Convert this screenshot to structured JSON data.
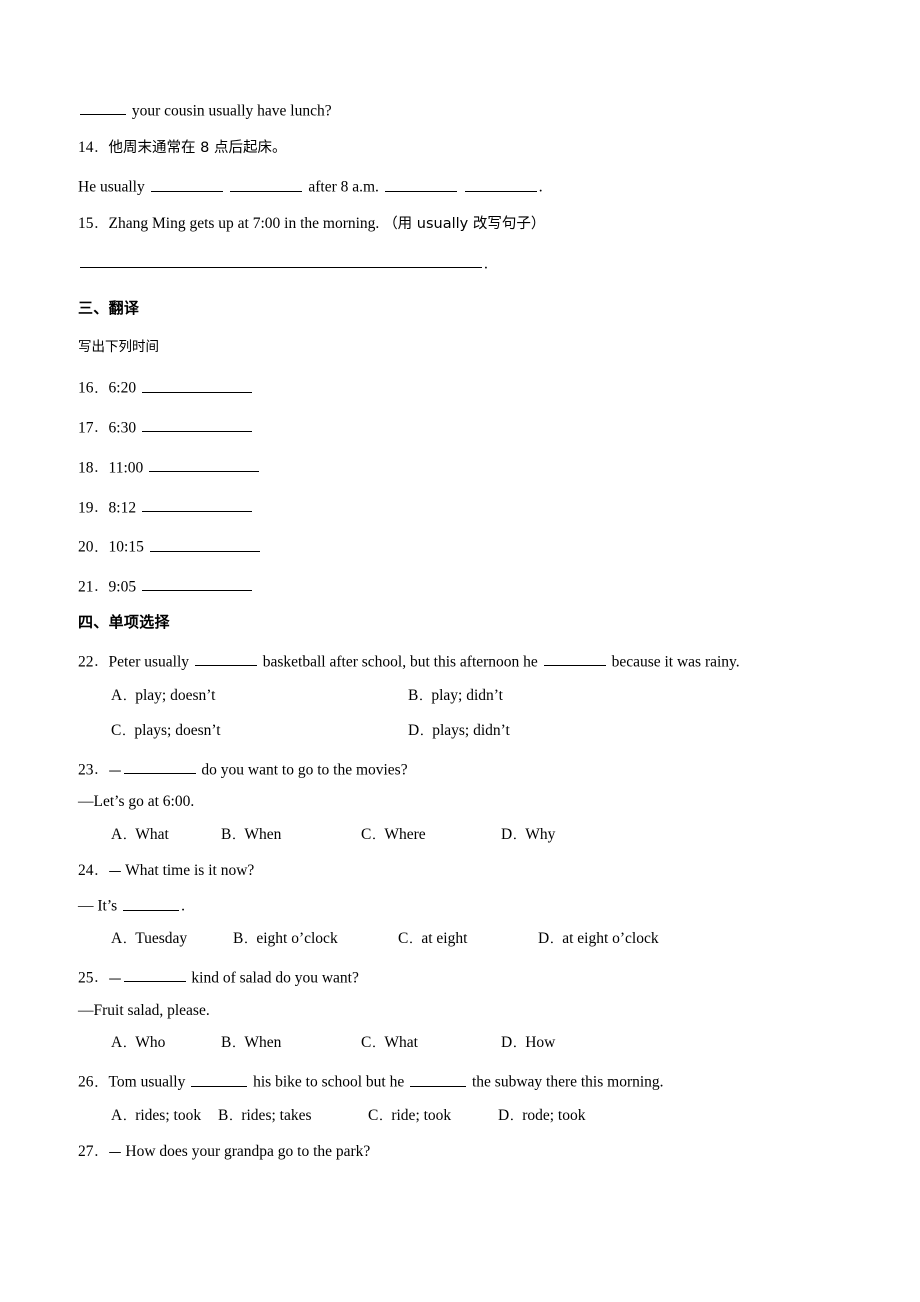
{
  "document": {
    "type": "worksheet",
    "language": "zh-CN/en"
  },
  "top_fragment": {
    "text_after_blank": "your cousin usually have lunch?"
  },
  "item14": {
    "number": "14",
    "sep": "．",
    "chinese": "他周末通常在 8 点后起床。",
    "answer_prefix": "He usually",
    "answer_middle": "after 8 a.m.",
    "answer_suffix": "."
  },
  "item15": {
    "number": "15",
    "sep": "．",
    "prompt": "Zhang Ming gets up at 7:00 in the morning.",
    "instruction": "（用 usually 改写句子）",
    "answer_suffix": "."
  },
  "section3": {
    "heading": "三、翻译",
    "instruction": "写出下列时间",
    "items": [
      {
        "number": "16",
        "sep": "．",
        "time": "6:20"
      },
      {
        "number": "17",
        "sep": "．",
        "time": "6:30"
      },
      {
        "number": "18",
        "sep": "．",
        "time": "11:00"
      },
      {
        "number": "19",
        "sep": "．",
        "time": "8:12"
      },
      {
        "number": "20",
        "sep": "．",
        "time": "10:15"
      },
      {
        "number": "21",
        "sep": "．",
        "time": "9:05"
      }
    ]
  },
  "section4": {
    "heading": "四、单项选择",
    "questions": [
      {
        "number": "22",
        "sep": "．",
        "stem_a": "Peter usually",
        "stem_b": "basketball after school, but this afternoon he",
        "stem_c": "because it was rainy.",
        "layout": "2col",
        "options": [
          {
            "letter": "A",
            "dot": "．",
            "text": "play; doesn’t"
          },
          {
            "letter": "B",
            "dot": "．",
            "text": "play; didn’t"
          },
          {
            "letter": "C",
            "dot": "．",
            "text": "plays; doesn’t"
          },
          {
            "letter": "D",
            "dot": "．",
            "text": "plays; didn’t"
          }
        ]
      },
      {
        "number": "23",
        "sep": "．",
        "dash": "—",
        "stem_after": "do you want to go to the movies?",
        "answer": "—Let’s go at 6:00.",
        "layout": "4a",
        "options": [
          {
            "letter": "A",
            "dot": "．",
            "text": "What"
          },
          {
            "letter": "B",
            "dot": "．",
            "text": "When"
          },
          {
            "letter": "C",
            "dot": "．",
            "text": "Where"
          },
          {
            "letter": "D",
            "dot": "．",
            "text": "Why"
          }
        ]
      },
      {
        "number": "24",
        "sep": "．",
        "dash": "—",
        "stem": "What time is it now?",
        "answer_prefix": "— It’s",
        "answer_suffix": ".",
        "layout": "4b",
        "options": [
          {
            "letter": "A",
            "dot": "．",
            "text": "Tuesday"
          },
          {
            "letter": "B",
            "dot": "．",
            "text": "eight o’clock"
          },
          {
            "letter": "C",
            "dot": "．",
            "text": "at eight"
          },
          {
            "letter": "D",
            "dot": "．",
            "text": "at eight o’clock"
          }
        ]
      },
      {
        "number": "25",
        "sep": "．",
        "dash": "—",
        "stem_after": "kind of salad do you want?",
        "answer": "—Fruit salad, please.",
        "layout": "4a",
        "options": [
          {
            "letter": "A",
            "dot": "．",
            "text": "Who"
          },
          {
            "letter": "B",
            "dot": "．",
            "text": "When"
          },
          {
            "letter": "C",
            "dot": "．",
            "text": "What"
          },
          {
            "letter": "D",
            "dot": "．",
            "text": "How"
          }
        ]
      },
      {
        "number": "26",
        "sep": "．",
        "stem_a": "Tom usually",
        "stem_b": "his bike to school but he",
        "stem_c": "the subway there this morning.",
        "layout": "4c",
        "options": [
          {
            "letter": "A",
            "dot": "．",
            "text": "rides; took"
          },
          {
            "letter": "B",
            "dot": "．",
            "text": "rides; takes"
          },
          {
            "letter": "C",
            "dot": "．",
            "text": "ride; took"
          },
          {
            "letter": "D",
            "dot": "．",
            "text": "rode; took"
          }
        ]
      },
      {
        "number": "27",
        "sep": "．",
        "dash": "—",
        "stem": "How does your grandpa go to the park?"
      }
    ]
  }
}
